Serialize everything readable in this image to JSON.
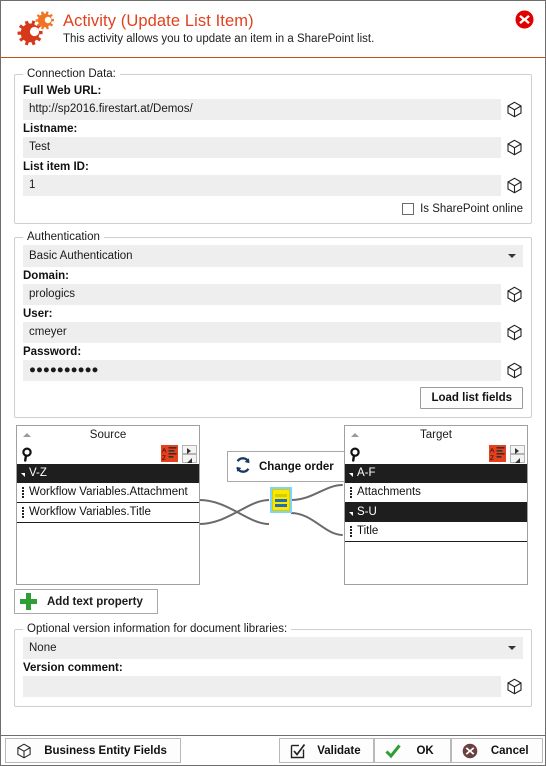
{
  "header": {
    "title": "Activity (Update List Item)",
    "subtitle": "This activity allows you to update an item in a SharePoint list.",
    "icon": "gears-icon",
    "close_icon": "close-circle-icon",
    "title_color": "#e2411e",
    "rule_color": "#c4501e"
  },
  "connection": {
    "legend": "Connection Data:",
    "full_web_url": {
      "label": "Full Web URL:",
      "value": "http://sp2016.firestart.at/Demos/"
    },
    "listname": {
      "label": "Listname:",
      "value": "Test"
    },
    "list_item_id": {
      "label": "List item ID:",
      "value": "1"
    },
    "sharepoint_online": {
      "label": "Is SharePoint online",
      "checked": false
    }
  },
  "authentication": {
    "legend": "Authentication",
    "mode": {
      "selected": "Basic Authentication"
    },
    "domain": {
      "label": "Domain:",
      "value": "prologics"
    },
    "user": {
      "label": "User:",
      "value": "cmeyer"
    },
    "password": {
      "label": "Password:",
      "value": "●●●●●●●●●●"
    }
  },
  "load_list_fields_button": "Load list fields",
  "mapping": {
    "change_order_button": "Change order",
    "source": {
      "title": "Source",
      "search_icon": "magnifier-icon",
      "sort_icon": "sort-az-icon",
      "groups": [
        {
          "label": "V-Z",
          "items": [
            "Workflow Variables.Attachment",
            "Workflow Variables.Title"
          ]
        }
      ]
    },
    "target": {
      "title": "Target",
      "search_icon": "magnifier-icon",
      "sort_icon": "sort-az-icon",
      "groups": [
        {
          "label": "A-F",
          "items": [
            "Attachments"
          ]
        },
        {
          "label": "S-U",
          "items": [
            "Title"
          ]
        }
      ]
    },
    "node_colors": {
      "fill": "#ffe600",
      "outline": "#7fd4ff",
      "bar": "#1f6fb5"
    }
  },
  "add_text_property_button": "Add text property",
  "version": {
    "legend": "Optional version information for document libraries:",
    "selected": "None",
    "comment_label": "Version comment:",
    "comment_value": ""
  },
  "footer": {
    "business_entity_fields": "Business Entity Fields",
    "validate": "Validate",
    "ok": "OK",
    "cancel": "Cancel",
    "ok_color": "#2f9e35",
    "cancel_color": "#6b4040"
  }
}
